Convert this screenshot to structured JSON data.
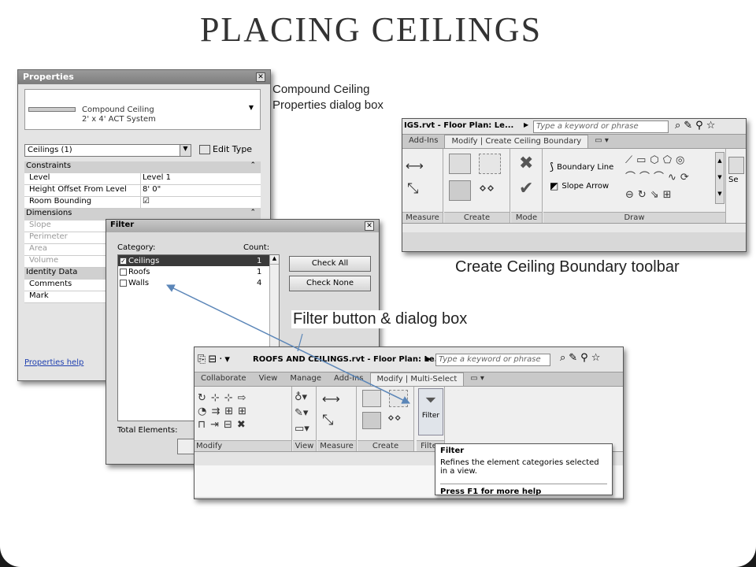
{
  "slide_title": "PLACING CEILINGS",
  "captions": {
    "compound": "Compound Ceiling Properties dialog box",
    "boundary": "Create Ceiling Boundary toolbar",
    "filter": "Filter button & dialog box"
  },
  "properties": {
    "title": "Properties",
    "type_family": "Compound Ceiling",
    "type_name": "2' x 4' ACT System",
    "selector": "Ceilings (1)",
    "edit_type": "Edit Type",
    "groups": [
      {
        "name": "Constraints",
        "rows": [
          {
            "k": "Level",
            "v": "Level 1"
          },
          {
            "k": "Height Offset From Level",
            "v": "8'  0\""
          },
          {
            "k": "Room Bounding",
            "v": "☑"
          }
        ]
      },
      {
        "name": "Dimensions",
        "rows": [
          {
            "k": "Slope",
            "v": ""
          },
          {
            "k": "Perimeter",
            "v": ""
          },
          {
            "k": "Area",
            "v": ""
          },
          {
            "k": "Volume",
            "v": ""
          }
        ]
      },
      {
        "name": "Identity Data",
        "rows": [
          {
            "k": "Comments",
            "v": ""
          },
          {
            "k": "Mark",
            "v": ""
          }
        ]
      }
    ],
    "help": "Properties help"
  },
  "filter": {
    "title": "Filter",
    "category_label": "Category:",
    "count_label": "Count:",
    "items": [
      {
        "name": "Ceilings",
        "count": "1",
        "checked": true
      },
      {
        "name": "Roofs",
        "count": "1",
        "checked": false
      },
      {
        "name": "Walls",
        "count": "4",
        "checked": false
      }
    ],
    "check_all": "Check All",
    "check_none": "Check None",
    "total": "Total Elements:"
  },
  "boundary_ribbon": {
    "file_title": "IGS.rvt - Floor Plan: Le...",
    "search_placeholder": "Type a keyword or phrase",
    "tabs": [
      "Add-Ins",
      "Modify | Create Ceiling Boundary"
    ],
    "boundary_line": "Boundary Line",
    "slope_arrow": "Slope Arrow",
    "se": "Se",
    "panels": [
      "Measure",
      "Create",
      "Mode",
      "Draw"
    ]
  },
  "multi_ribbon": {
    "file_title": "ROOFS AND CEILINGS.rvt - Floor Plan: Le...",
    "search_placeholder": "Type a keyword or phrase",
    "tabs": [
      "Collaborate",
      "View",
      "Manage",
      "Add-Ins",
      "Modify | Multi-Select"
    ],
    "panels": [
      "Modify",
      "View",
      "Measure",
      "Create",
      "Filter"
    ],
    "filter_button": "Filter"
  },
  "tooltip": {
    "title": "Filter",
    "desc": "Refines the element categories selected in a view.",
    "help": "Press F1 for more help"
  }
}
